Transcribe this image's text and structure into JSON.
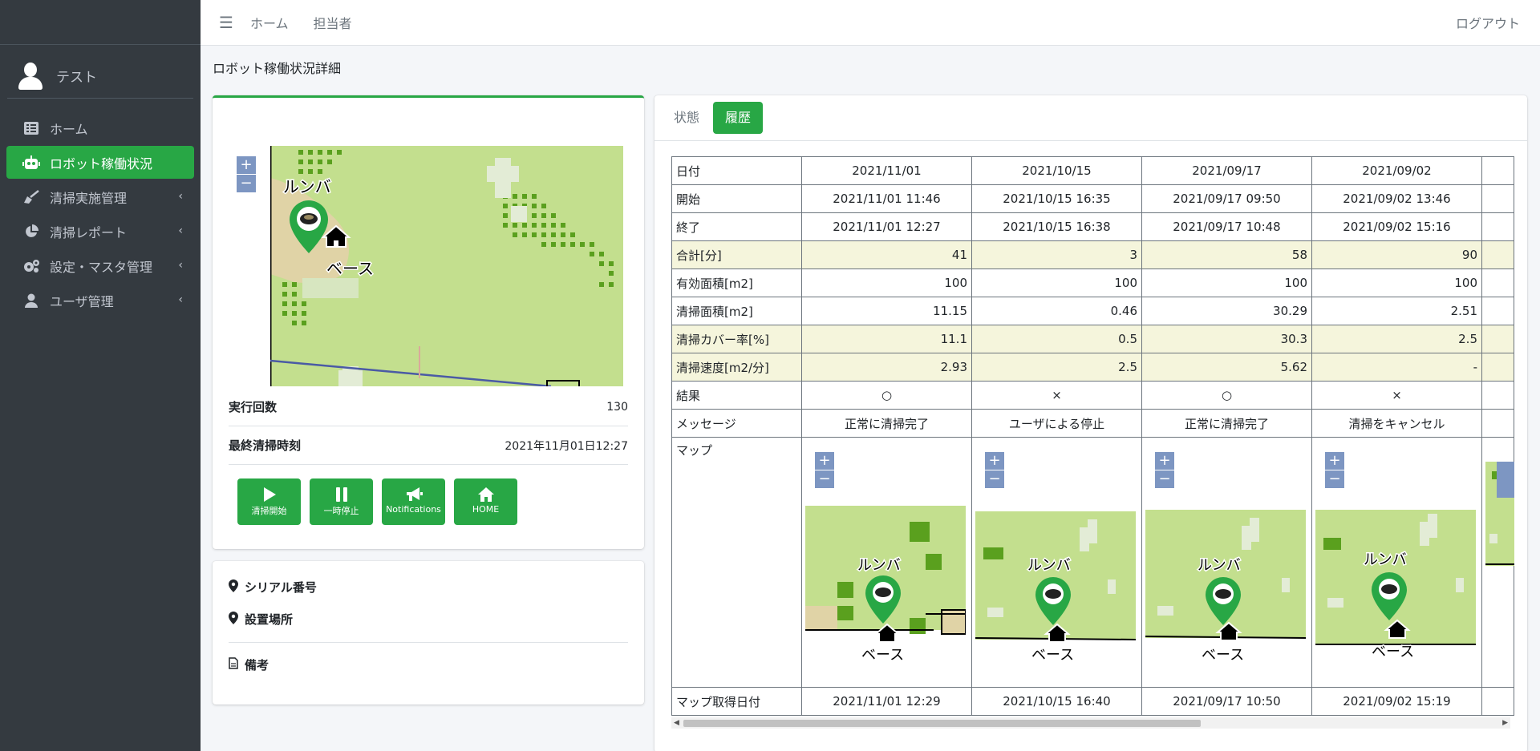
{
  "sidebar": {
    "user_name": "テスト",
    "items": [
      {
        "label": "ホーム",
        "icon": "list-icon",
        "active": false
      },
      {
        "label": "ロボット稼働状況",
        "icon": "robot-icon",
        "active": true
      },
      {
        "label": "清掃実施管理",
        "icon": "broom-icon",
        "active": false,
        "chevron": "‹"
      },
      {
        "label": "清掃レポート",
        "icon": "pie-chart-icon",
        "active": false,
        "chevron": "‹"
      },
      {
        "label": "設定・マスタ管理",
        "icon": "gears-icon",
        "active": false,
        "chevron": "‹"
      },
      {
        "label": "ユーザ管理",
        "icon": "user-icon",
        "active": false,
        "chevron": "‹"
      }
    ]
  },
  "topbar": {
    "menu_icon": "☰",
    "home_link": "ホーム",
    "staff_link": "担当者",
    "logout": "ログアウト"
  },
  "page_title": "ロボット稼働状況詳細",
  "robot": {
    "map_label_robot": "ルンバ",
    "map_label_base": "ベース",
    "zoom_in": "+",
    "zoom_out": "−",
    "run_count_label": "実行回数",
    "run_count_value": "130",
    "last_clean_label": "最終清掃時刻",
    "last_clean_value": "2021年11月01日12:27",
    "buttons": {
      "start": "清掃開始",
      "pause": "一時停止",
      "notifications": "Notifications",
      "home": "HOME"
    }
  },
  "info": {
    "serial_label": "シリアル番号",
    "location_label": "設置場所",
    "notes_label": "備考"
  },
  "tabs": {
    "status": "状態",
    "history": "履歴"
  },
  "history": {
    "row_labels": {
      "date": "日付",
      "start": "開始",
      "end": "終了",
      "total": "合計[分]",
      "effective_area": "有効面積[m2]",
      "cleaned_area": "清掃面積[m2]",
      "coverage": "清掃カバー率[%]",
      "speed": "清掃速度[m2/分]",
      "result": "結果",
      "message": "メッセージ",
      "map": "マップ",
      "map_date": "マップ取得日付"
    },
    "columns": [
      {
        "date": "2021/11/01",
        "start": "2021/11/01 11:46",
        "end": "2021/11/01 12:27",
        "total": "41",
        "effective_area": "100",
        "cleaned_area": "11.15",
        "coverage": "11.1",
        "speed": "2.93",
        "result": "○",
        "message": "正常に清掃完了",
        "map_date": "2021/11/01 12:29"
      },
      {
        "date": "2021/10/15",
        "start": "2021/10/15 16:35",
        "end": "2021/10/15 16:38",
        "total": "3",
        "effective_area": "100",
        "cleaned_area": "0.46",
        "coverage": "0.5",
        "speed": "2.5",
        "result": "×",
        "message": "ユーザによる停止",
        "map_date": "2021/10/15 16:40"
      },
      {
        "date": "2021/09/17",
        "start": "2021/09/17 09:50",
        "end": "2021/09/17 10:48",
        "total": "58",
        "effective_area": "100",
        "cleaned_area": "30.29",
        "coverage": "30.3",
        "speed": "5.62",
        "result": "○",
        "message": "正常に清掃完了",
        "map_date": "2021/09/17 10:50"
      },
      {
        "date": "2021/09/02",
        "start": "2021/09/02 13:46",
        "end": "2021/09/02 15:16",
        "total": "90",
        "effective_area": "100",
        "cleaned_area": "2.51",
        "coverage": "2.5",
        "speed": "-",
        "result": "×",
        "message": "清掃をキャンセル",
        "map_date": "2021/09/02 15:19"
      }
    ]
  },
  "colors": {
    "sidebar_bg": "#343a40",
    "accent": "#28a745",
    "map_green": "#c3df8e",
    "map_dark_green": "#5aa01e",
    "map_sand": "#e0d3a6",
    "highlight_row": "#f5f5dc"
  }
}
